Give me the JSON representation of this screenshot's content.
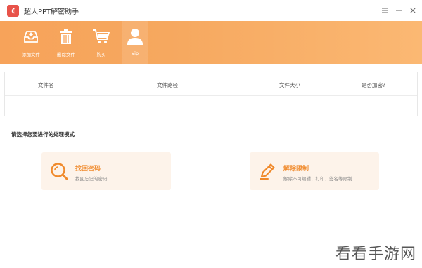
{
  "window": {
    "title": "超人PPT解密助手",
    "controls": [
      "menu-icon",
      "minimize-icon",
      "close-icon"
    ]
  },
  "toolbar": {
    "items": [
      {
        "label": "添加文件",
        "icon": "add-file-icon"
      },
      {
        "label": "删除文件",
        "icon": "trash-icon"
      },
      {
        "label": "购买",
        "icon": "cart-icon"
      },
      {
        "label": "Vip",
        "icon": "user-icon"
      }
    ]
  },
  "table": {
    "headers": [
      "文件名",
      "文件路径",
      "文件大小",
      "是否加密?"
    ]
  },
  "mode": {
    "prompt": "请选择您要进行的处理模式",
    "cards": [
      {
        "title": "找回密码",
        "subtitle": "找回忘记的密码",
        "icon": "search-icon"
      },
      {
        "title": "解除限制",
        "subtitle": "解除不可编辑、打印、签名等限制",
        "icon": "pencil-icon"
      }
    ]
  },
  "watermark": "看看手游网",
  "colors": {
    "accent": "#f7a35a",
    "card_bg": "#fdf3ea",
    "card_title": "#f08a2c"
  }
}
